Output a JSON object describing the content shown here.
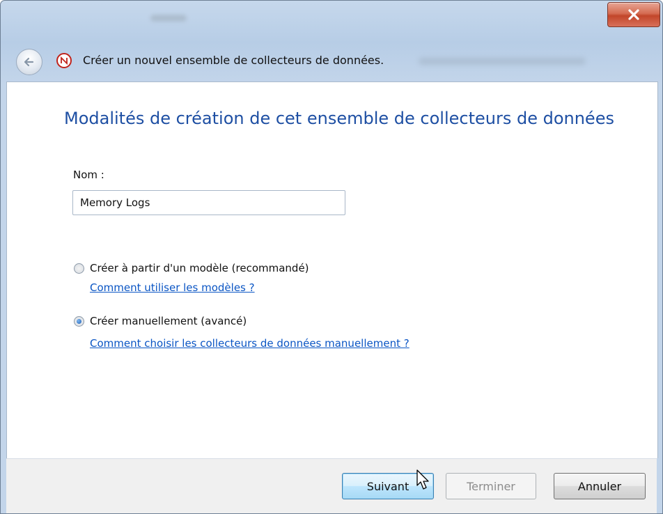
{
  "window": {
    "close_icon": "close-icon",
    "close_color": "#c2462a"
  },
  "header": {
    "back_icon": "back-arrow-icon",
    "app_icon": "performance-monitor-icon",
    "title": "Créer un nouvel ensemble de collecteurs de données."
  },
  "main": {
    "heading": "Modalités de création de cet ensemble de collecteurs de données",
    "name_label": "Nom :",
    "name_value": "Memory Logs",
    "options": [
      {
        "label": "Créer à partir d'un modèle (recommandé)",
        "link": "Comment utiliser les modèles ?",
        "checked": false
      },
      {
        "label": "Créer manuellement (avancé)",
        "link": "Comment choisir les collecteurs de données manuellement ?",
        "checked": true
      }
    ]
  },
  "footer": {
    "next_label": "Suivant",
    "finish_label": "Terminer",
    "cancel_label": "Annuler"
  },
  "colors": {
    "heading": "#1e4fa3",
    "link": "#0a55c4"
  }
}
